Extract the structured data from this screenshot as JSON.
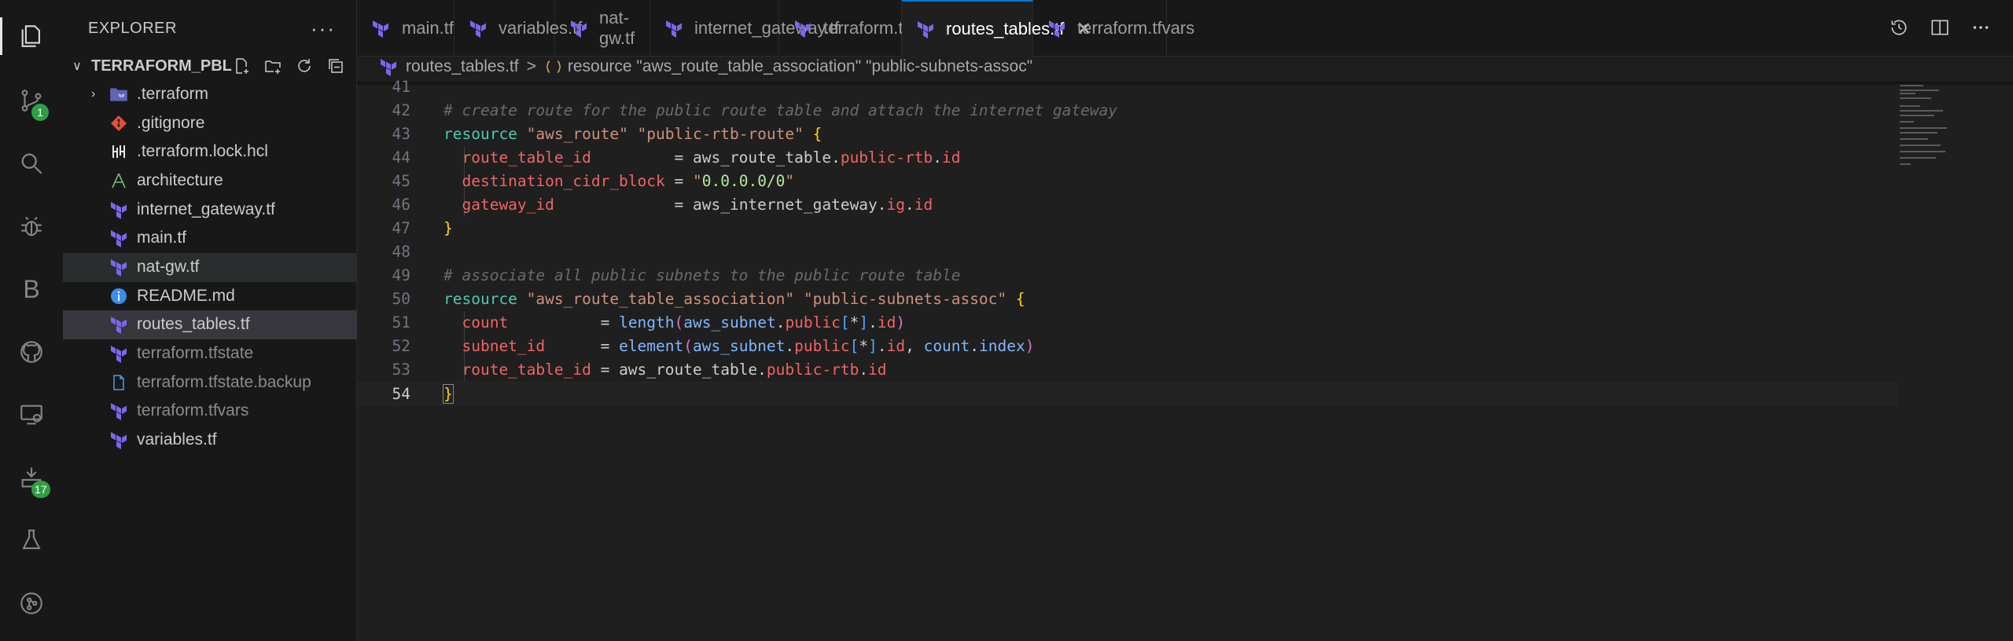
{
  "sidebar": {
    "title": "EXPLORER",
    "more": "···",
    "root": {
      "name": "TERRAFORM_PBL",
      "chevron": "∨"
    },
    "items": [
      {
        "name": ".terraform",
        "icon": "folder-terraform-icon",
        "folder": true,
        "chevron": "›"
      },
      {
        "name": ".gitignore",
        "icon": "git-icon"
      },
      {
        "name": ".terraform.lock.hcl",
        "icon": "hcl-icon"
      },
      {
        "name": "architecture",
        "icon": "drawio-icon"
      },
      {
        "name": "internet_gateway.tf",
        "icon": "terraform-icon"
      },
      {
        "name": "main.tf",
        "icon": "terraform-icon"
      },
      {
        "name": "nat-gw.tf",
        "icon": "terraform-icon"
      },
      {
        "name": "README.md",
        "icon": "info-icon"
      },
      {
        "name": "routes_tables.tf",
        "icon": "terraform-icon"
      },
      {
        "name": "terraform.tfstate",
        "icon": "terraform-icon",
        "dim": true
      },
      {
        "name": "terraform.tfstate.backup",
        "icon": "file-icon",
        "dim": true
      },
      {
        "name": "terraform.tfvars",
        "icon": "terraform-icon",
        "dim": true
      },
      {
        "name": "variables.tf",
        "icon": "terraform-icon"
      }
    ]
  },
  "activity": {
    "scm_badge": "1",
    "extensions_badge": "17",
    "b_letter": "B"
  },
  "tabs": [
    {
      "label": "main.tf"
    },
    {
      "label": "variables.tf"
    },
    {
      "label": "nat-gw.tf"
    },
    {
      "label": "internet_gateway.tf"
    },
    {
      "label": "terraform.tfstate"
    },
    {
      "label": "routes_tables.tf",
      "active": true,
      "close": "✕"
    },
    {
      "label": "terraform.tfvars"
    }
  ],
  "breadcrumbs": {
    "file": "routes_tables.tf",
    "separator": ">",
    "symbol": "resource \"aws_route_table_association\" \"public-subnets-assoc\""
  },
  "editor": {
    "lines": [
      {
        "n": "41",
        "tokens": []
      },
      {
        "n": "42",
        "tokens": [
          {
            "t": "# create route for the public route table and attach the internet gateway",
            "c": "t-com"
          }
        ]
      },
      {
        "n": "43",
        "tokens": [
          {
            "t": "resource ",
            "c": "t-kw"
          },
          {
            "t": "\"aws_route\" \"public-rtb-route\"",
            "c": "t-str"
          },
          {
            "t": " ",
            "c": "t-plain"
          },
          {
            "t": "{",
            "c": "t-brk"
          }
        ]
      },
      {
        "n": "44",
        "tokens": [
          {
            "t": "  route_table_id",
            "c": "t-attr"
          },
          {
            "t": "         = aws_route_table.",
            "c": "t-plain"
          },
          {
            "t": "public-rtb",
            "c": "t-attr"
          },
          {
            "t": ".",
            "c": "t-plain"
          },
          {
            "t": "id",
            "c": "t-attr"
          }
        ]
      },
      {
        "n": "45",
        "tokens": [
          {
            "t": "  destination_cidr_block",
            "c": "t-attr"
          },
          {
            "t": " = ",
            "c": "t-plain"
          },
          {
            "t": "\"",
            "c": "t-str"
          },
          {
            "t": "0.0.0.0/0",
            "c": "t-strg"
          },
          {
            "t": "\"",
            "c": "t-str"
          }
        ]
      },
      {
        "n": "46",
        "tokens": [
          {
            "t": "  gateway_id",
            "c": "t-attr"
          },
          {
            "t": "             = aws_internet_gateway.",
            "c": "t-plain"
          },
          {
            "t": "ig",
            "c": "t-attr"
          },
          {
            "t": ".",
            "c": "t-plain"
          },
          {
            "t": "id",
            "c": "t-attr"
          }
        ]
      },
      {
        "n": "47",
        "tokens": [
          {
            "t": "}",
            "c": "t-brk"
          }
        ]
      },
      {
        "n": "48",
        "tokens": []
      },
      {
        "n": "49",
        "tokens": [
          {
            "t": "# associate all public subnets to the public route table",
            "c": "t-com"
          }
        ]
      },
      {
        "n": "50",
        "tokens": [
          {
            "t": "resource ",
            "c": "t-kw"
          },
          {
            "t": "\"aws_route_table_association\" \"public-subnets-assoc\"",
            "c": "t-str"
          },
          {
            "t": " ",
            "c": "t-plain"
          },
          {
            "t": "{",
            "c": "t-brk"
          }
        ]
      },
      {
        "n": "51",
        "tokens": [
          {
            "t": "  count",
            "c": "t-attr"
          },
          {
            "t": "          = ",
            "c": "t-plain"
          },
          {
            "t": "length",
            "c": "t-fn"
          },
          {
            "t": "(",
            "c": "t-brk2"
          },
          {
            "t": "aws_subnet",
            "c": "t-fn"
          },
          {
            "t": ".",
            "c": "t-plain"
          },
          {
            "t": "public",
            "c": "t-attr"
          },
          {
            "t": "[",
            "c": "t-brk3"
          },
          {
            "t": "*",
            "c": "t-plain"
          },
          {
            "t": "]",
            "c": "t-brk3"
          },
          {
            "t": ".",
            "c": "t-plain"
          },
          {
            "t": "id",
            "c": "t-attr"
          },
          {
            "t": ")",
            "c": "t-brk2"
          }
        ]
      },
      {
        "n": "52",
        "tokens": [
          {
            "t": "  subnet_id",
            "c": "t-attr"
          },
          {
            "t": "      = ",
            "c": "t-plain"
          },
          {
            "t": "element",
            "c": "t-fn"
          },
          {
            "t": "(",
            "c": "t-brk2"
          },
          {
            "t": "aws_subnet",
            "c": "t-fn"
          },
          {
            "t": ".",
            "c": "t-plain"
          },
          {
            "t": "public",
            "c": "t-attr"
          },
          {
            "t": "[",
            "c": "t-brk3"
          },
          {
            "t": "*",
            "c": "t-plain"
          },
          {
            "t": "]",
            "c": "t-brk3"
          },
          {
            "t": ".",
            "c": "t-plain"
          },
          {
            "t": "id",
            "c": "t-attr"
          },
          {
            "t": ", ",
            "c": "t-plain"
          },
          {
            "t": "count",
            "c": "t-fn"
          },
          {
            "t": ".",
            "c": "t-plain"
          },
          {
            "t": "index",
            "c": "t-fn"
          },
          {
            "t": ")",
            "c": "t-brk2"
          }
        ]
      },
      {
        "n": "53",
        "tokens": [
          {
            "t": "  route_table_id",
            "c": "t-attr"
          },
          {
            "t": " = aws_route_table.",
            "c": "t-plain"
          },
          {
            "t": "public-rtb",
            "c": "t-attr"
          },
          {
            "t": ".",
            "c": "t-plain"
          },
          {
            "t": "id",
            "c": "t-attr"
          }
        ]
      },
      {
        "n": "54",
        "current": true,
        "tokens": [
          {
            "t": "}",
            "c": "t-brk cursor-brace"
          }
        ]
      }
    ]
  },
  "colors": {
    "accent": "#0078d4",
    "terraform": "#7b68ee",
    "badge": "#2ea043"
  }
}
